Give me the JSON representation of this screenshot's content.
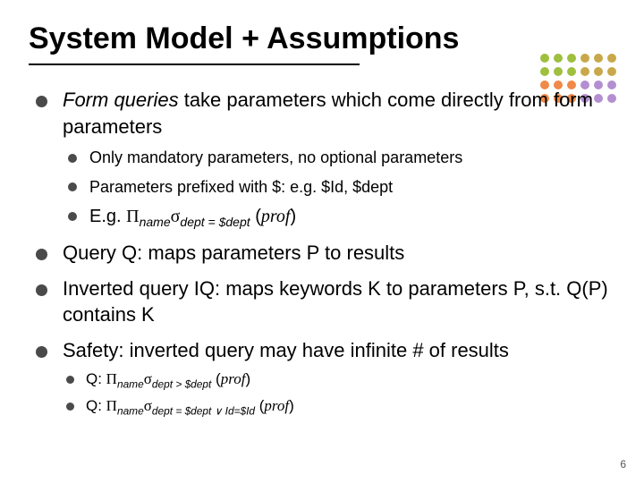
{
  "title": "System Model + Assumptions",
  "main1": {
    "lead_italic": "Form queries",
    "lead_rest": " take parameters which come directly from form parameters",
    "sub1": "Only mandatory parameters, no optional parameters",
    "sub2": "Parameters prefixed with $: e.g. $Id, $dept",
    "sub3_prefix": "E.g. ",
    "sub3_pi": "Π",
    "sub3_pisub": "name",
    "sub3_sigma": "σ",
    "sub3_sigmasub": "dept = $dept",
    "sub3_paren_open": " (",
    "sub3_prof": "prof",
    "sub3_paren_close": ")"
  },
  "main2": "Query Q: maps parameters P to results",
  "main3": "Inverted query IQ: maps keywords K to parameters P, s.t. Q(P) contains K",
  "main4": {
    "text": "Safety: inverted query may have infinite # of results",
    "q1_prefix": "Q: ",
    "q1_pi": "Π",
    "q1_pisub": "name",
    "q1_sigma": "σ",
    "q1_sigmasub": "dept > $dept",
    "q1_paren_open": " (",
    "q1_prof": "prof",
    "q1_paren_close": ")",
    "q2_prefix": "Q: ",
    "q2_pi": "Π",
    "q2_pisub": "name",
    "q2_sigma": "σ",
    "q2_sigmasub": "dept = $dept ∨ Id=$Id",
    "q2_paren_open": " (",
    "q2_prof": "prof",
    "q2_paren_close": ")"
  },
  "page": "6",
  "dot_colors": [
    "#9fbf3f",
    "#9fbf3f",
    "#9fbf3f",
    "#c8a84a",
    "#c8a84a",
    "#c8a84a",
    "#9fbf3f",
    "#9fbf3f",
    "#9fbf3f",
    "#c8a84a",
    "#c8a84a",
    "#c8a84a",
    "#ef8a4a",
    "#ef8a4a",
    "#ef8a4a",
    "#b38fd1",
    "#b38fd1",
    "#b38fd1",
    "#ef8a4a",
    "#ef8a4a",
    "#ef8a4a",
    "#b38fd1",
    "#b38fd1",
    "#b38fd1"
  ]
}
